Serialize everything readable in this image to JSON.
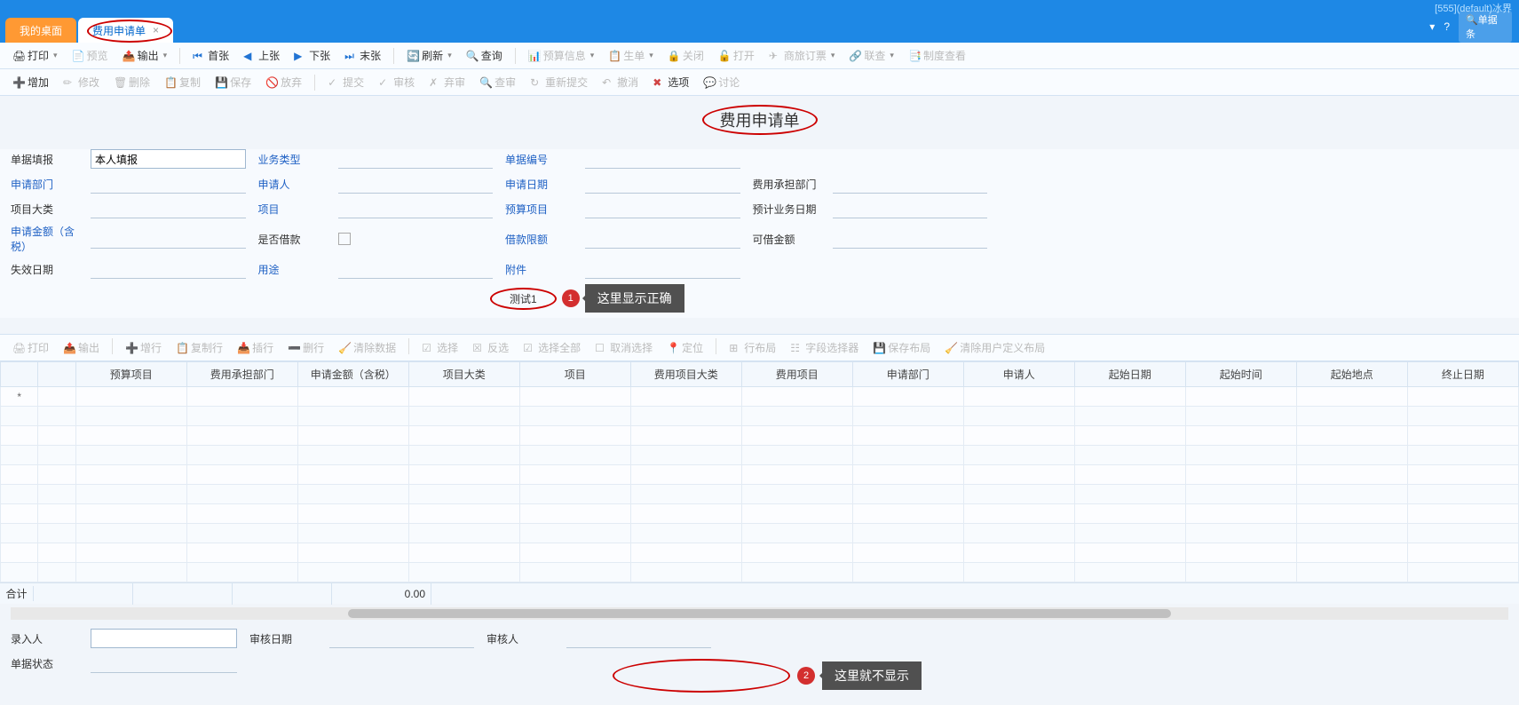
{
  "titlebar": {
    "text": "[555](default)冰界"
  },
  "header": {
    "search_icon": "🔍",
    "search_placeholder": "单据条",
    "help_icon": "?",
    "dropdown_icon": "▾"
  },
  "tabs": [
    {
      "label": "我的桌面",
      "active": "home"
    },
    {
      "label": "费用申请单",
      "active": "white",
      "closable": true
    }
  ],
  "toolbar1": [
    {
      "label": "打印",
      "icon": "🖨",
      "dd": true
    },
    {
      "label": "预览",
      "icon": "📄",
      "disabled": true
    },
    {
      "label": "输出",
      "icon": "📤",
      "dd": true
    },
    {
      "sep": true
    },
    {
      "label": "首张",
      "icon": "⏮",
      "color": "#2274d4"
    },
    {
      "label": "上张",
      "icon": "◀",
      "color": "#2274d4"
    },
    {
      "label": "下张",
      "icon": "▶",
      "color": "#2274d4"
    },
    {
      "label": "末张",
      "icon": "⏭",
      "color": "#2274d4"
    },
    {
      "sep": true
    },
    {
      "label": "刷新",
      "icon": "🔄",
      "dd": true
    },
    {
      "label": "查询",
      "icon": "🔍"
    },
    {
      "sep": true
    },
    {
      "label": "预算信息",
      "icon": "📊",
      "dd": true,
      "disabled": true
    },
    {
      "label": "生单",
      "icon": "📋",
      "dd": true,
      "disabled": true
    },
    {
      "label": "关闭",
      "icon": "🔒",
      "disabled": true
    },
    {
      "label": "打开",
      "icon": "🔓",
      "disabled": true
    },
    {
      "label": "商旅订票",
      "icon": "✈",
      "dd": true,
      "disabled": true
    },
    {
      "label": "联查",
      "icon": "🔗",
      "dd": true,
      "disabled": true
    },
    {
      "label": "制度查看",
      "icon": "📑",
      "disabled": true
    }
  ],
  "toolbar2": [
    {
      "label": "增加",
      "icon": "➕"
    },
    {
      "label": "修改",
      "icon": "✏",
      "disabled": true
    },
    {
      "label": "删除",
      "icon": "🗑",
      "disabled": true
    },
    {
      "label": "复制",
      "icon": "📋",
      "disabled": true
    },
    {
      "label": "保存",
      "icon": "💾",
      "disabled": true
    },
    {
      "label": "放弃",
      "icon": "🚫",
      "disabled": true
    },
    {
      "sep": true
    },
    {
      "label": "提交",
      "icon": "✓",
      "disabled": true
    },
    {
      "label": "审核",
      "icon": "✓",
      "disabled": true
    },
    {
      "label": "弃审",
      "icon": "✗",
      "disabled": true
    },
    {
      "label": "查审",
      "icon": "🔍",
      "disabled": true
    },
    {
      "label": "重新提交",
      "icon": "↻",
      "disabled": true
    },
    {
      "label": "撤消",
      "icon": "↶",
      "disabled": true
    },
    {
      "label": "选项",
      "icon": "✖",
      "color": "#d04444"
    },
    {
      "label": "讨论",
      "icon": "💬",
      "disabled": true
    }
  ],
  "page_title": "费用申请单",
  "form": {
    "rows": [
      [
        {
          "label": "单据填报",
          "value": "本人填报",
          "boxed": true
        },
        {
          "label": "业务类型",
          "link": true
        },
        {
          "label": "单据编号",
          "link": true
        },
        null
      ],
      [
        {
          "label": "申请部门",
          "link": true
        },
        {
          "label": "申请人",
          "link": true
        },
        {
          "label": "申请日期",
          "link": true
        },
        {
          "label": "费用承担部门"
        }
      ],
      [
        {
          "label": "项目大类"
        },
        {
          "label": "项目",
          "link": true
        },
        {
          "label": "预算项目",
          "link": true
        },
        {
          "label": "预计业务日期"
        }
      ],
      [
        {
          "label": "申请金额（含税）",
          "link": true
        },
        {
          "label": "是否借款",
          "checkbox": true
        },
        {
          "label": "借款限额",
          "link": true
        },
        {
          "label": "可借金额"
        }
      ],
      [
        {
          "label": "失效日期"
        },
        {
          "label": "用途",
          "link": true
        },
        {
          "label": "附件",
          "link": true
        },
        null
      ]
    ]
  },
  "annot1": {
    "text": "测试1",
    "badge": "1",
    "tooltip": "这里显示正确"
  },
  "grid_toolbar": [
    {
      "label": "打印",
      "icon": "🖨",
      "disabled": true
    },
    {
      "label": "输出",
      "icon": "📤",
      "disabled": true
    },
    {
      "sep": true
    },
    {
      "label": "增行",
      "icon": "➕",
      "disabled": true
    },
    {
      "label": "复制行",
      "icon": "📋",
      "disabled": true
    },
    {
      "label": "插行",
      "icon": "📥",
      "disabled": true
    },
    {
      "label": "删行",
      "icon": "➖",
      "disabled": true
    },
    {
      "label": "清除数据",
      "icon": "🧹",
      "disabled": true
    },
    {
      "sep": true
    },
    {
      "label": "选择",
      "icon": "☑",
      "disabled": true
    },
    {
      "label": "反选",
      "icon": "☒",
      "disabled": true
    },
    {
      "label": "选择全部",
      "icon": "☑",
      "disabled": true
    },
    {
      "label": "取消选择",
      "icon": "☐",
      "disabled": true
    },
    {
      "label": "定位",
      "icon": "📍",
      "disabled": true
    },
    {
      "sep": true
    },
    {
      "label": "行布局",
      "icon": "⊞",
      "disabled": true
    },
    {
      "label": "字段选择器",
      "icon": "☷",
      "disabled": true
    },
    {
      "label": "保存布局",
      "icon": "💾",
      "disabled": true
    },
    {
      "label": "清除用户定义布局",
      "icon": "🧹",
      "disabled": true
    }
  ],
  "grid": {
    "columns": [
      "预算项目",
      "费用承担部门",
      "申请金额（含税）",
      "项目大类",
      "项目",
      "费用项目大类",
      "费用项目",
      "申请部门",
      "申请人",
      "起始日期",
      "起始时间",
      "起始地点",
      "终止日期"
    ],
    "marker": "*",
    "total_label": "合计",
    "total_value3": "0.00"
  },
  "footer_form": {
    "rows": [
      [
        {
          "label": "录入人",
          "boxed": true
        },
        {
          "label": "审核日期"
        },
        {
          "label": "审核人"
        },
        null
      ],
      [
        {
          "label": "单据状态"
        },
        null,
        null,
        null
      ]
    ]
  },
  "annot2": {
    "badge": "2",
    "tooltip": "这里就不显示"
  }
}
